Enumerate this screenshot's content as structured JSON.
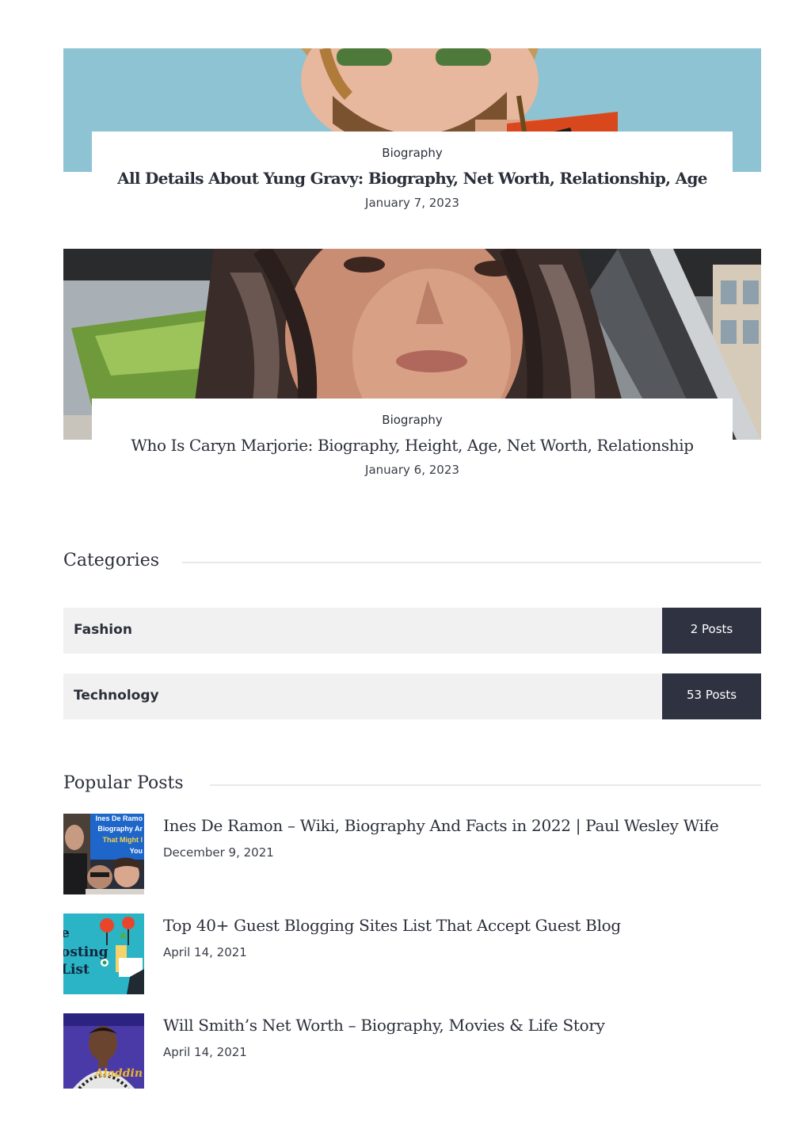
{
  "featured_posts": [
    {
      "category": "Biography",
      "title": "All Details About Yung Gravy: Biography, Net Worth, Relationship, Age",
      "date": "January 7, 2023",
      "image": "yung-gravy-photo"
    },
    {
      "category": "Biography",
      "title": "Who Is Caryn Marjorie: Biography, Height, Age, Net Worth, Relationship",
      "date": "January 6, 2023",
      "image": "caryn-marjorie-photo"
    }
  ],
  "categories": {
    "heading": "Categories",
    "items": [
      {
        "name": "Fashion",
        "count": "2 Posts"
      },
      {
        "name": "Technology",
        "count": "53 Posts"
      }
    ]
  },
  "popular_posts": {
    "heading": "Popular Posts",
    "items": [
      {
        "title": "Ines De Ramon – Wiki, Biography And Facts in 2022 | Paul Wesley Wife",
        "date": "December 9, 2021",
        "thumb_text": [
          "Ines De Ramo",
          "Biography Ar",
          "That Might I",
          "You"
        ]
      },
      {
        "title": "Top 40+ Guest Blogging Sites List That Accept Guest Blog",
        "date": "April 14, 2021",
        "thumb_text": [
          "e",
          "osting",
          "List"
        ]
      },
      {
        "title": "Will Smith’s Net Worth – Biography, Movies & Life Story",
        "date": "April 14, 2021",
        "thumb_text": [
          "Aladdin"
        ]
      }
    ]
  },
  "colors": {
    "text": "#2b2f3a",
    "count_badge": "#2f3241",
    "category_row": "#f1f1f1",
    "rule": "#e9e9ec"
  }
}
